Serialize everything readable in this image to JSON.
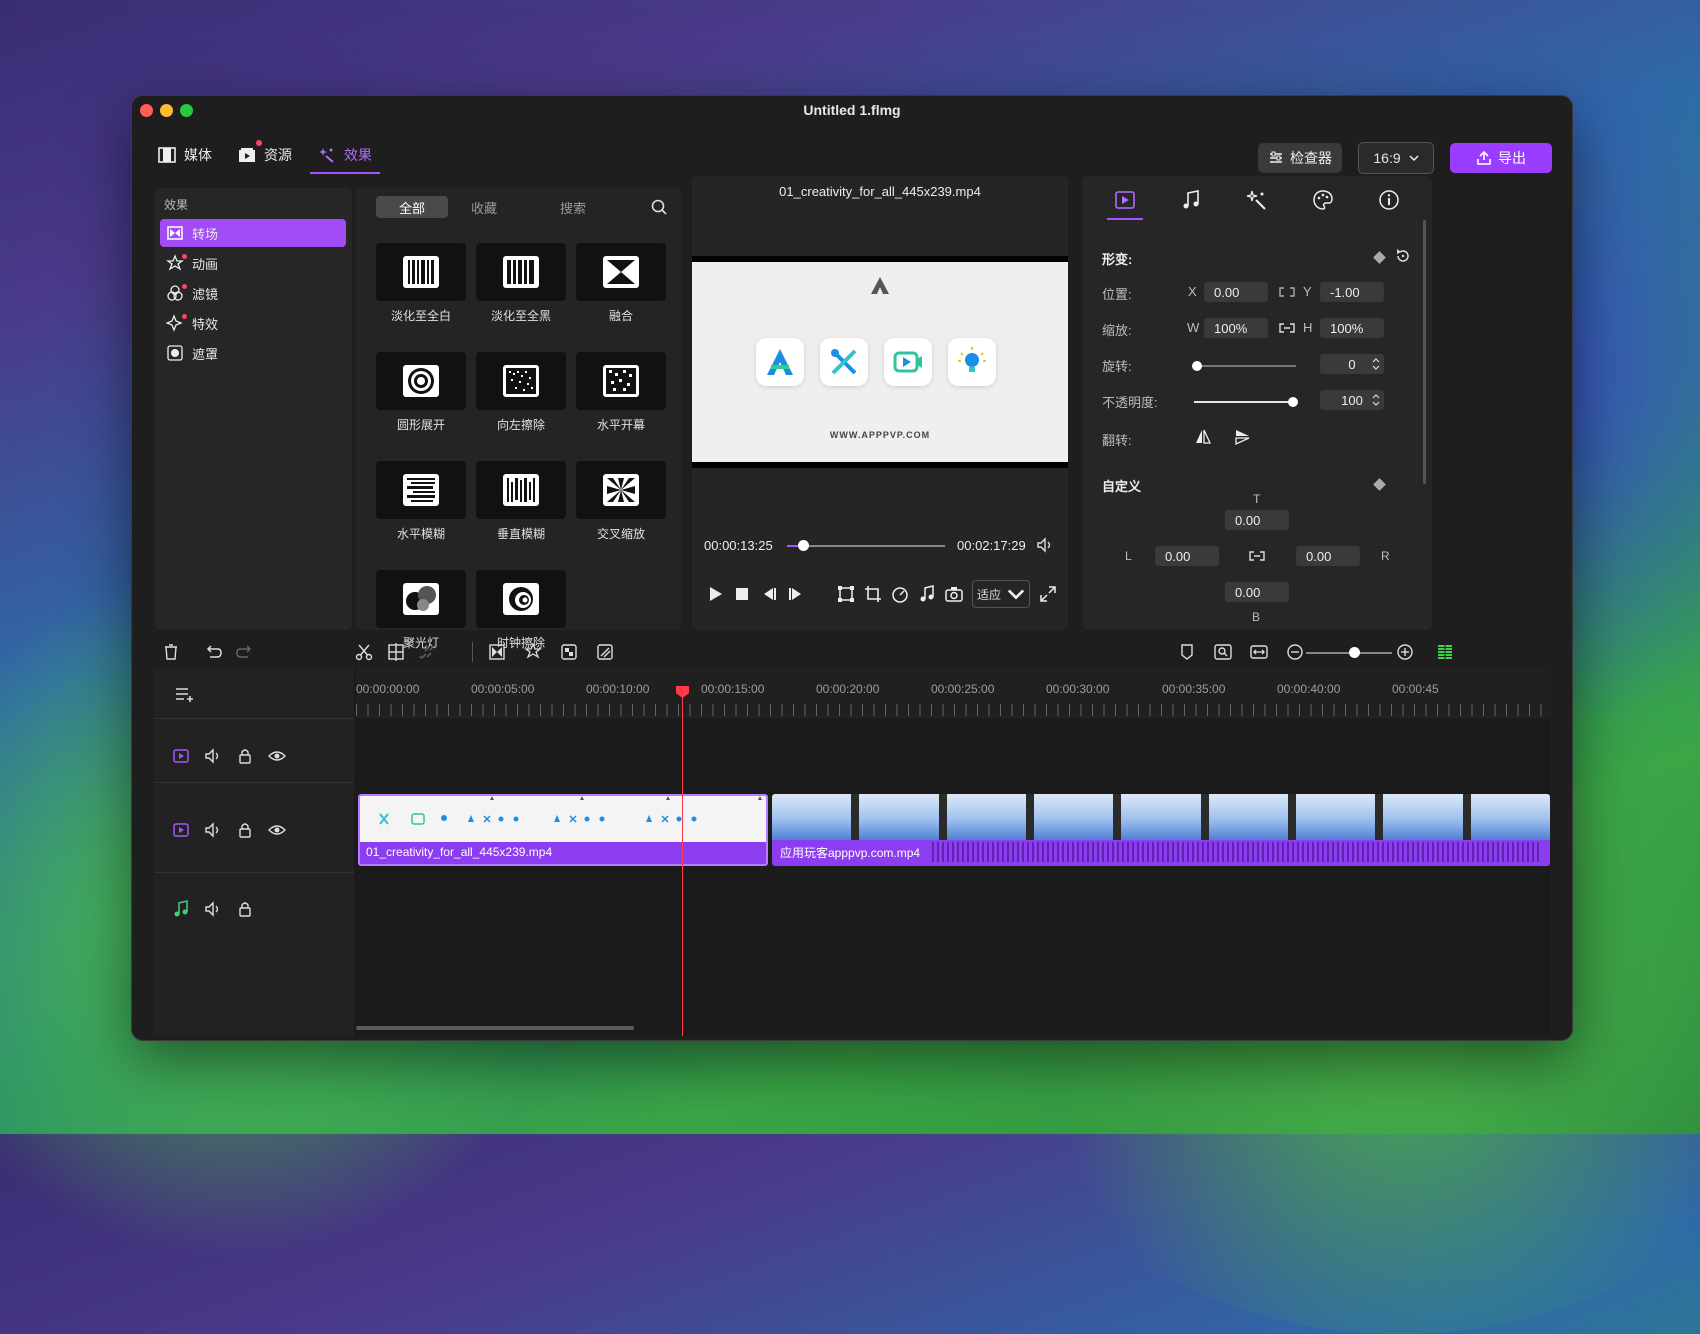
{
  "window": {
    "title": "Untitled 1.flmg"
  },
  "topnav": [
    {
      "label": "媒体",
      "icon": "film-icon"
    },
    {
      "label": "资源",
      "icon": "resource-icon"
    },
    {
      "label": "效果",
      "icon": "magic-icon"
    }
  ],
  "topright": {
    "inspector_label": "检查器",
    "ratio_value": "16:9",
    "export_label": "导出"
  },
  "left_panel": {
    "heading": "效果",
    "items": [
      {
        "label": "转场",
        "icon": "transition-icon",
        "active": true
      },
      {
        "label": "动画",
        "icon": "animation-icon"
      },
      {
        "label": "滤镜",
        "icon": "filter-icon"
      },
      {
        "label": "特效",
        "icon": "sparkle-icon"
      },
      {
        "label": "遮罩",
        "icon": "mask-icon"
      }
    ]
  },
  "gallery": {
    "tabs": [
      "全部",
      "收藏",
      "搜索"
    ],
    "items": [
      {
        "label": "淡化至全白",
        "icon": "fade-white-icon"
      },
      {
        "label": "淡化至全黑",
        "icon": "fade-black-icon"
      },
      {
        "label": "融合",
        "icon": "merge-icon"
      },
      {
        "label": "圆形展开",
        "icon": "circle-expand-icon"
      },
      {
        "label": "向左擦除",
        "icon": "wipe-left-icon"
      },
      {
        "label": "水平开幕",
        "icon": "horizontal-open-icon"
      },
      {
        "label": "水平模糊",
        "icon": "horizontal-blur-icon"
      },
      {
        "label": "垂直模糊",
        "icon": "vertical-blur-icon"
      },
      {
        "label": "交叉缩放",
        "icon": "cross-zoom-icon"
      },
      {
        "label": "聚光灯",
        "icon": "spotlight-icon"
      },
      {
        "label": "时钟擦除",
        "icon": "clock-wipe-icon"
      }
    ]
  },
  "preview": {
    "file_name": "01_creativity_for_all_445x239.mp4",
    "url_text": "WWW.APPPVP.COM",
    "current_time": "00:00:13:25",
    "total_time": "00:02:17:29",
    "progress": 0.1,
    "fit_label": "适应"
  },
  "inspector": {
    "transform_title": "形变:",
    "position_label": "位置:",
    "pos_x_axis": "X",
    "pos_x": "0.00",
    "pos_y_axis": "Y",
    "pos_y": "-1.00",
    "scale_label": "缩放:",
    "scale_w_axis": "W",
    "scale_w": "100%",
    "scale_h_axis": "H",
    "scale_h": "100%",
    "rotation_label": "旋转:",
    "rotation": "0",
    "opacity_label": "不透明度:",
    "opacity": "100",
    "flip_label": "翻转:",
    "custom_title": "自定义",
    "t_label": "T",
    "t_value": "0.00",
    "l_label": "L",
    "l_value": "0.00",
    "r_label": "R",
    "r_value": "0.00",
    "b_value": "0.00",
    "b_label": "B"
  },
  "timeline": {
    "ruler": [
      "00:00:00:00",
      "00:00:05:00",
      "00:00:10:00",
      "00:00:15:00",
      "00:00:20:00",
      "00:00:25:00",
      "00:00:30:00",
      "00:00:35:00",
      "00:00:40:00",
      "00:00:45"
    ],
    "clip1_label": "01_creativity_for_all_445x239.mp4",
    "clip2_label": "应用玩客apppvp.com.mp4"
  },
  "colors": {
    "accent": "#a654ff",
    "playhead": "#ff3b4a",
    "track_clip": "#8d3df0"
  }
}
